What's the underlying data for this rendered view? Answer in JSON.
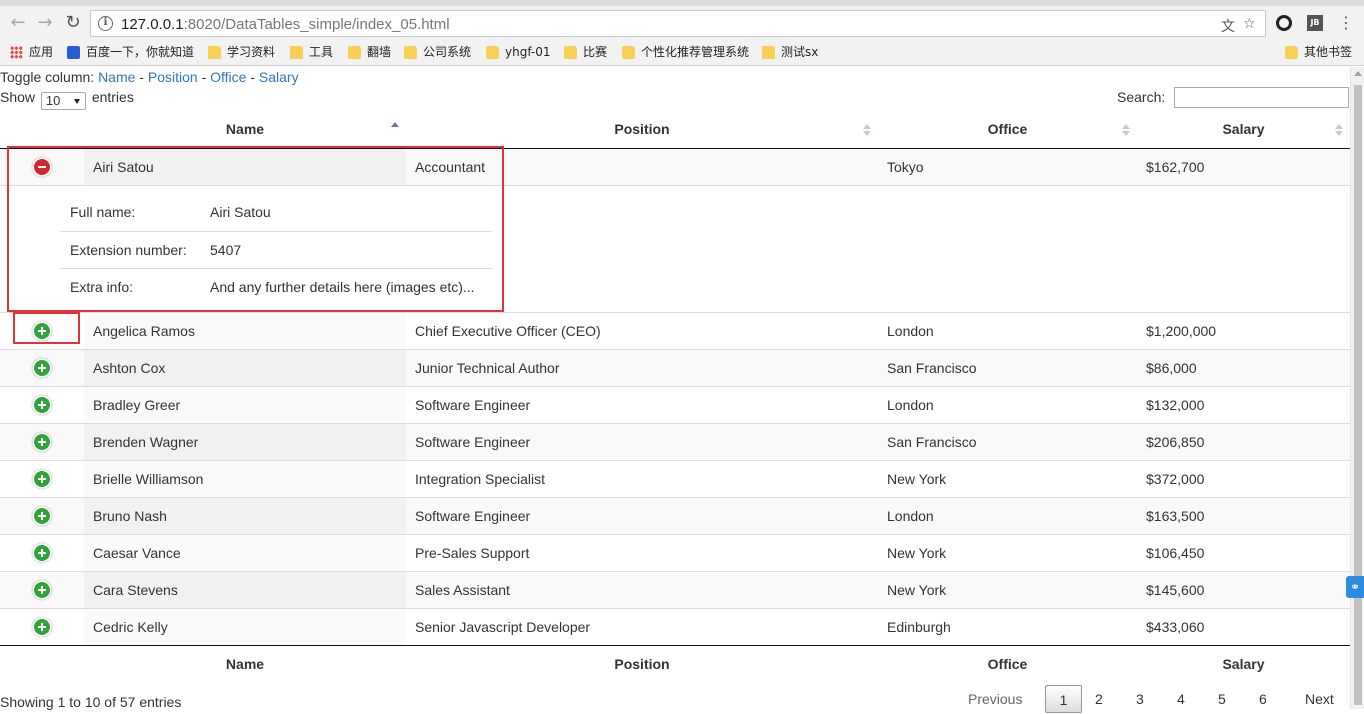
{
  "browser": {
    "url_host": "127.0.0.1",
    "url_rest": ":8020/DataTables_simple/index_05.html",
    "bookmarks": [
      "应用",
      "百度一下，你就知道",
      "学习资料",
      "工具",
      "翻墙",
      "公司系统",
      "yhgf-01",
      "比赛",
      "个性化推荐管理系统",
      "测试sx"
    ],
    "other_bookmarks": "其他书签",
    "ext_badge": "JB"
  },
  "toggle": {
    "label": "Toggle column:",
    "links": [
      "Name",
      "Position",
      "Office",
      "Salary"
    ],
    "separator": " - "
  },
  "length": {
    "show": "Show",
    "value": "10",
    "entries": "entries"
  },
  "search": {
    "label": "Search:",
    "value": ""
  },
  "table": {
    "headers": [
      "Name",
      "Position",
      "Office",
      "Salary"
    ],
    "sort_column": "Name",
    "sort_direction": "ascending",
    "rows": [
      {
        "name": "Airi Satou",
        "position": "Accountant",
        "office": "Tokyo",
        "salary": "$162,700",
        "expanded": true
      },
      {
        "name": "Angelica Ramos",
        "position": "Chief Executive Officer (CEO)",
        "office": "London",
        "salary": "$1,200,000",
        "expanded": false
      },
      {
        "name": "Ashton Cox",
        "position": "Junior Technical Author",
        "office": "San Francisco",
        "salary": "$86,000",
        "expanded": false
      },
      {
        "name": "Bradley Greer",
        "position": "Software Engineer",
        "office": "London",
        "salary": "$132,000",
        "expanded": false
      },
      {
        "name": "Brenden Wagner",
        "position": "Software Engineer",
        "office": "San Francisco",
        "salary": "$206,850",
        "expanded": false
      },
      {
        "name": "Brielle Williamson",
        "position": "Integration Specialist",
        "office": "New York",
        "salary": "$372,000",
        "expanded": false
      },
      {
        "name": "Bruno Nash",
        "position": "Software Engineer",
        "office": "London",
        "salary": "$163,500",
        "expanded": false
      },
      {
        "name": "Caesar Vance",
        "position": "Pre-Sales Support",
        "office": "New York",
        "salary": "$106,450",
        "expanded": false
      },
      {
        "name": "Cara Stevens",
        "position": "Sales Assistant",
        "office": "New York",
        "salary": "$145,600",
        "expanded": false
      },
      {
        "name": "Cedric Kelly",
        "position": "Senior Javascript Developer",
        "office": "Edinburgh",
        "salary": "$433,060",
        "expanded": false
      }
    ],
    "detail": [
      {
        "label": "Full name:",
        "value": "Airi Satou"
      },
      {
        "label": "Extension number:",
        "value": "5407"
      },
      {
        "label": "Extra info:",
        "value": "And any further details here (images etc)..."
      }
    ]
  },
  "footer": {
    "info": "Showing 1 to 10 of 57 entries",
    "previous": "Previous",
    "pages": [
      "1",
      "2",
      "3",
      "4",
      "5",
      "6"
    ],
    "current_page": "1",
    "next": "Next"
  },
  "colors": {
    "link": "#3174c7",
    "open_button": "#2fa43a",
    "close_button": "#d3262e",
    "highlight_box": "#e0343a"
  }
}
